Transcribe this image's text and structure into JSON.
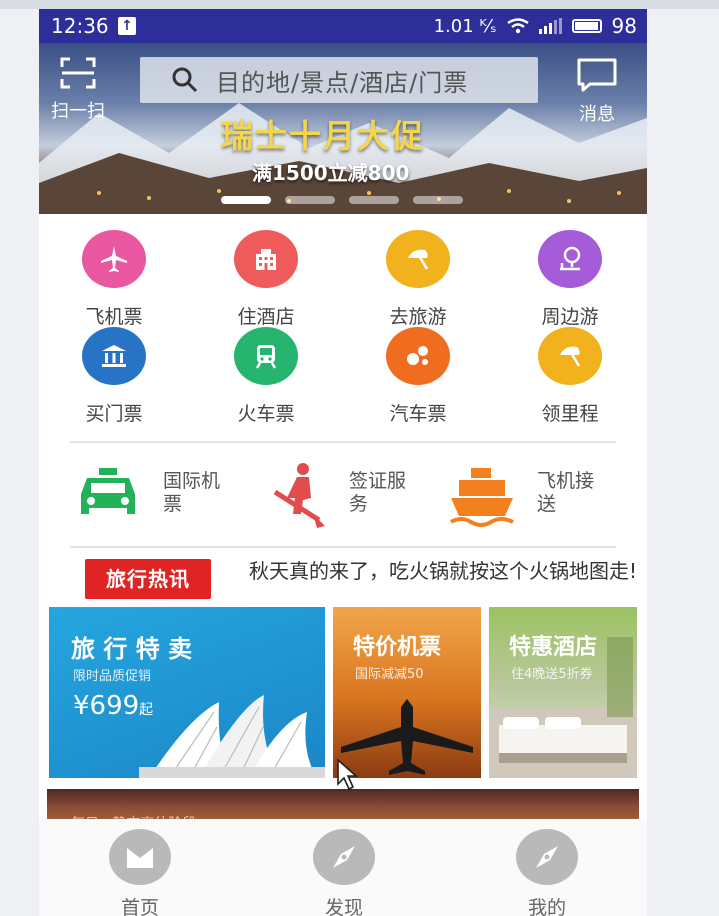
{
  "status_bar": {
    "time": "12:36",
    "network_speed": "1.01 ᴷ⁄ₛ",
    "battery": "98"
  },
  "header": {
    "scan_label": "扫一扫",
    "search_placeholder": "目的地/景点/酒店/门票",
    "message_label": "消息"
  },
  "banner": {
    "title": "瑞士十月大促",
    "subtitle": "满1500立减800",
    "dots": 4,
    "active_dot": 0
  },
  "categories": [
    {
      "label": "飞机票",
      "icon": "airplane-icon",
      "color": "#e857a0"
    },
    {
      "label": "住酒店",
      "icon": "building-icon",
      "color": "#ef5b5b"
    },
    {
      "label": "去旅游",
      "icon": "umbrella-icon",
      "color": "#f2b21d"
    },
    {
      "label": "周边游",
      "icon": "tree-icon",
      "color": "#a65bd8"
    },
    {
      "label": "买门票",
      "icon": "museum-icon",
      "color": "#2774c7"
    },
    {
      "label": "火车票",
      "icon": "train-icon",
      "color": "#25b56f"
    },
    {
      "label": "汽车票",
      "icon": "dots-icon",
      "color": "#f06c1e"
    },
    {
      "label": "领里程",
      "icon": "umbrella-icon",
      "color": "#f2b21d"
    }
  ],
  "services": [
    {
      "label": "国际机票",
      "icon": "taxi-icon",
      "color": "#22b35a"
    },
    {
      "label": "签证服务",
      "icon": "worker-icon",
      "color": "#e24c4c"
    },
    {
      "label": "飞机接送",
      "icon": "ship-icon",
      "color": "#f2801f"
    }
  ],
  "news": {
    "badge": "旅行热讯",
    "text": "秋天真的来了，吃火锅就按这个火锅地图走!"
  },
  "promo_cards": [
    {
      "title": "旅 行 特 卖",
      "subtitle": "限时品质促销",
      "price": "¥699",
      "price_suffix": "起"
    },
    {
      "title": "特价机票",
      "subtitle": "国际减减50"
    },
    {
      "title": "特惠酒店",
      "subtitle": "住4晚送5折券"
    }
  ],
  "promo_strip": {
    "text": "每日 · 静态高估阶段"
  },
  "tabs": [
    {
      "label": "首页",
      "icon": "home-icon"
    },
    {
      "label": "发现",
      "icon": "compass-icon"
    },
    {
      "label": "我的",
      "icon": "compass-icon"
    }
  ]
}
